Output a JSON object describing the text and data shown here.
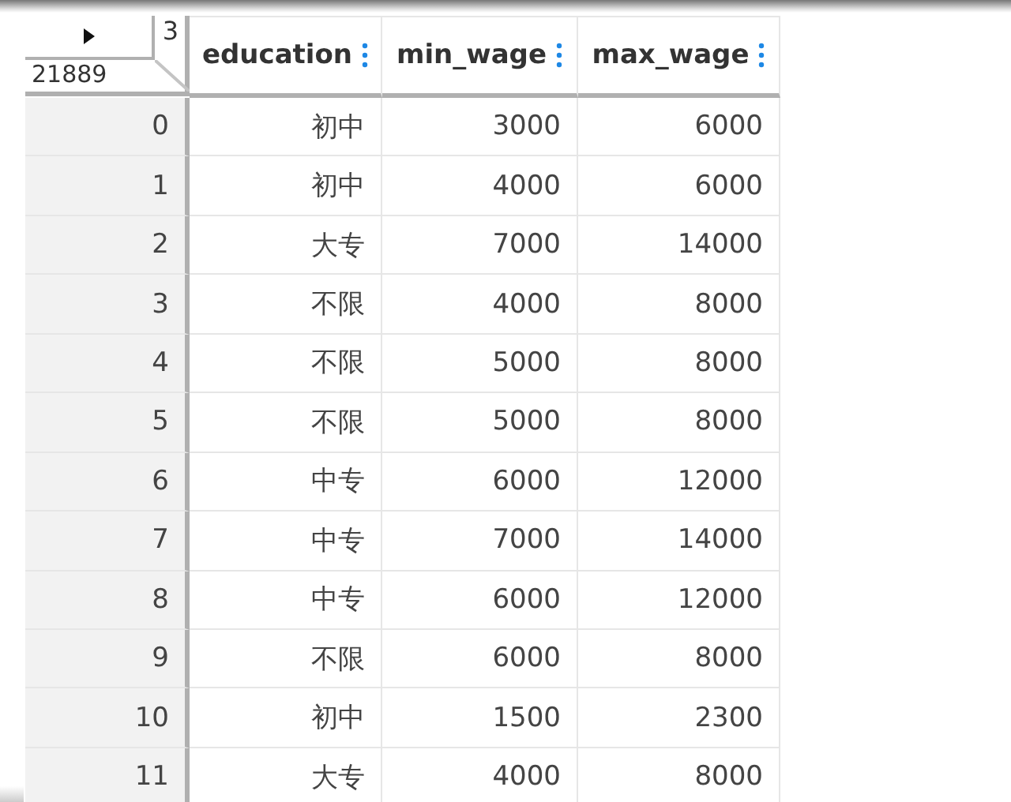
{
  "table": {
    "corner": {
      "columns_count": "3",
      "rows_count": "21889"
    },
    "columns": [
      "education",
      "min_wage",
      "max_wage"
    ],
    "rows": [
      {
        "index": "0",
        "education": "初中",
        "min_wage": "3000",
        "max_wage": "6000"
      },
      {
        "index": "1",
        "education": "初中",
        "min_wage": "4000",
        "max_wage": "6000"
      },
      {
        "index": "2",
        "education": "大专",
        "min_wage": "7000",
        "max_wage": "14000"
      },
      {
        "index": "3",
        "education": "不限",
        "min_wage": "4000",
        "max_wage": "8000"
      },
      {
        "index": "4",
        "education": "不限",
        "min_wage": "5000",
        "max_wage": "8000"
      },
      {
        "index": "5",
        "education": "不限",
        "min_wage": "5000",
        "max_wage": "8000"
      },
      {
        "index": "6",
        "education": "中专",
        "min_wage": "6000",
        "max_wage": "12000"
      },
      {
        "index": "7",
        "education": "中专",
        "min_wage": "7000",
        "max_wage": "14000"
      },
      {
        "index": "8",
        "education": "中专",
        "min_wage": "6000",
        "max_wage": "12000"
      },
      {
        "index": "9",
        "education": "不限",
        "min_wage": "6000",
        "max_wage": "8000"
      },
      {
        "index": "10",
        "education": "初中",
        "min_wage": "1500",
        "max_wage": "2300"
      },
      {
        "index": "11",
        "education": "大专",
        "min_wage": "4000",
        "max_wage": "8000"
      }
    ]
  }
}
